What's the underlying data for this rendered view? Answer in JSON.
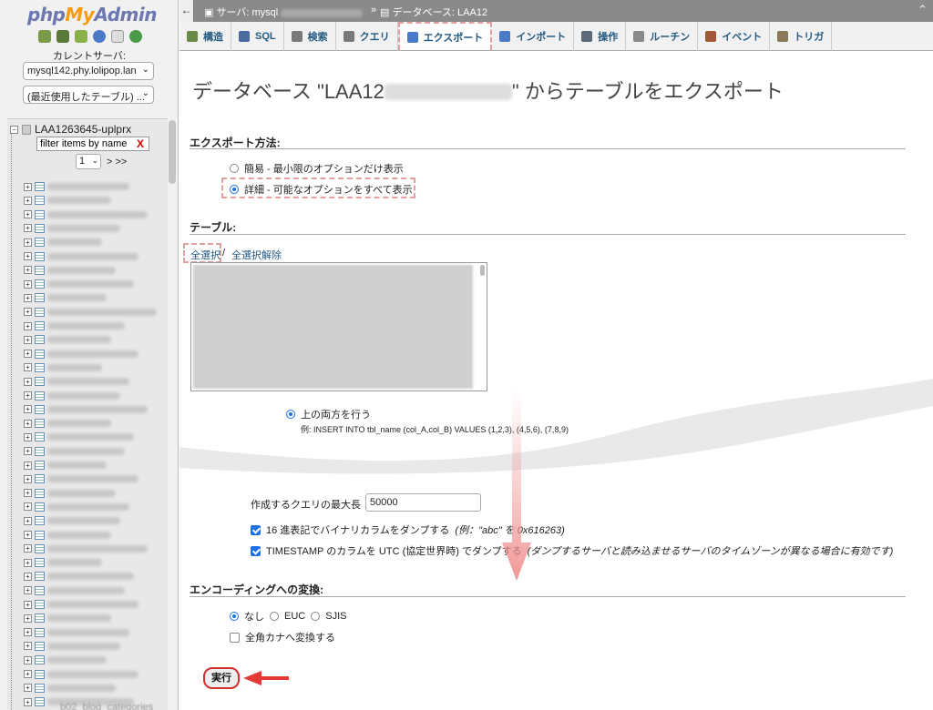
{
  "logo": {
    "php": "php",
    "my": "My",
    "admin": "Admin"
  },
  "left": {
    "current_server_label": "カレントサーバ:",
    "server": "mysql142.phy.lolipop.lan",
    "recent": "(最近使用したテーブル) ...",
    "db_name": "LAA1263645-uplprx",
    "filter_placeholder": "filter items by name",
    "filter_clear": "X",
    "page": "1",
    "page_next": "> >>",
    "last_table": "b02_blog_categories"
  },
  "topbar": {
    "back": "←",
    "server_crumb": "サーバ: mysql",
    "sep": "»",
    "db_crumb": "データベース: LAA12",
    "right_icon": "⌃"
  },
  "tabs": [
    {
      "label": "構造",
      "icon": "structure-icon"
    },
    {
      "label": "SQL",
      "icon": "sql-icon"
    },
    {
      "label": "検索",
      "icon": "search-icon"
    },
    {
      "label": "クエリ",
      "icon": "query-icon"
    },
    {
      "label": "エクスポート",
      "icon": "export-icon",
      "active": true
    },
    {
      "label": "インポート",
      "icon": "import-icon"
    },
    {
      "label": "操作",
      "icon": "wrench-icon"
    },
    {
      "label": "ルーチン",
      "icon": "routines-icon"
    },
    {
      "label": "イベント",
      "icon": "events-icon"
    },
    {
      "label": "トリガ",
      "icon": "triggers-icon"
    }
  ],
  "main": {
    "title_pre": "データベース \"LAA12",
    "title_post": "\" からテーブルをエクスポート",
    "export_method_head": "エクスポート方法:",
    "method_quick": "簡易 - 最小限のオプションだけ表示",
    "method_custom": "詳細 - 可能なオプションをすべて表示",
    "tables_head": "テーブル:",
    "select_all": "全選択",
    "select_sep": "/",
    "deselect_all": "全選択解除",
    "both_label": "上の両方を行う",
    "both_example": "例: INSERT INTO tbl_name (col_A,col_B) VALUES (1,2,3), (4,5,6), (7,8,9)",
    "max_query_label": "作成するクエリの最大長",
    "max_query_value": "50000",
    "hex_label": "16 進表記でバイナリカラムをダンプする",
    "hex_note": "(例：\"abc\" を 0x616263)",
    "utc_label": "TIMESTAMP のカラムを UTC (協定世界時) でダンプする",
    "utc_note": "(ダンプするサーバと読み込ませるサーバのタイムゾーンが異なる場合に有効です)",
    "encoding_head": "エンコーディングへの変換:",
    "enc_none": "なし",
    "enc_euc": "EUC",
    "enc_sjis": "SJIS",
    "kana_label": "全角カナへ変換する",
    "run": "実行"
  },
  "colors": {
    "accent": "#235a81",
    "highlight_dash": "#e4a0a0",
    "arrow": "#e53935",
    "radio": "#1b72e8"
  }
}
